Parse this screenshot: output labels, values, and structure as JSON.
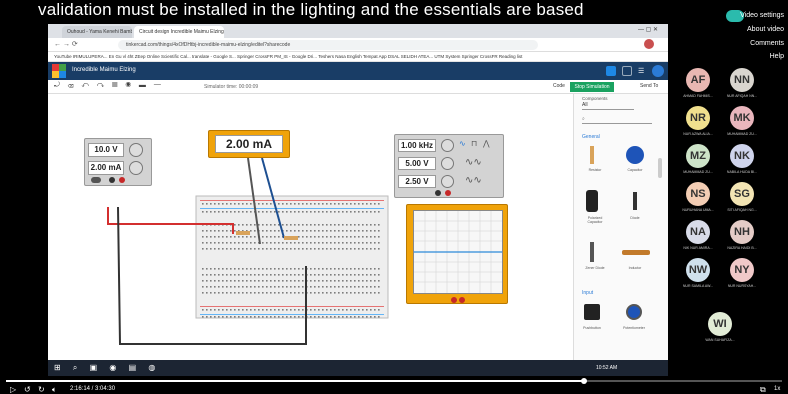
{
  "caption": "validation must be installed in the lighting and the essentials are based",
  "overlay_menu": [
    "Video settings",
    "About video",
    "Comments",
    "Help"
  ],
  "browser": {
    "tabs": [
      "Ouhoud - Yama Kenehi Bambu",
      "Circuit design Incredible Maimu Elzing"
    ],
    "url": "tinkercad.com/things/4xOfDHtbj-incredible-maimu-elzing/editel?sharecode",
    "bookmarks": "YouTube  IRIMULUPERA...  En Gu vl 4ht ZEep  Online Scientific Cal...  translate - Google S...  Springer CrossFR  PM_IS - Google Dri...  Teshers Nasa  English Tempat App  DSAL SELIDH ATEA...  UTM System  Springer CrossFR  Reading list"
  },
  "app": {
    "name": "Incredible Maimu Elzing",
    "sim_time": "Simulator time: 00:00:09",
    "code_label": "Code",
    "stop_label": "Stop Simulation",
    "send_label": "Send To"
  },
  "power_supply": {
    "voltage": "10.0 V",
    "current": "2.00 mA"
  },
  "multimeter": {
    "reading": "2.00 mA"
  },
  "function_generator": {
    "frequency": "1.00 kHz",
    "amplitude": "5.00 V",
    "offset": "2.50 V"
  },
  "sidepanel": {
    "header": "Components",
    "filter": "All",
    "section_general": "General",
    "section_input": "Input",
    "components": [
      "Resistor",
      "Capacitor",
      "Polarized Capacitor",
      "Diode",
      "Zener Diode",
      "Inductor",
      "Pushbutton",
      "Potentiometer"
    ]
  },
  "taskbar": {
    "time": "10:52 AM"
  },
  "participants": [
    {
      "initials": "AF",
      "name": "AHMAD FAHMIS...",
      "color": "#e8b7b2"
    },
    {
      "initials": "NN",
      "name": "NUR AFIQAH NN...",
      "color": "#d9d5cf"
    },
    {
      "initials": "NR",
      "name": "NUR AZWA ALIA...",
      "color": "#f1e08e"
    },
    {
      "initials": "MK",
      "name": "MUHAMMAD ZU...",
      "color": "#e9b6bd"
    },
    {
      "initials": "MZ",
      "name": "MUHAMMAD ZU...",
      "color": "#cde3c8"
    },
    {
      "initials": "NK",
      "name": "NABILA HUDA BI...",
      "color": "#cfd4ec"
    },
    {
      "initials": "NS",
      "name": "NURUHANA UMA...",
      "color": "#f3cdb4"
    },
    {
      "initials": "SG",
      "name": "SITI AFIQAH NG...",
      "color": "#f3e5b4"
    },
    {
      "initials": "NA",
      "name": "NIK NUR AMIRA...",
      "color": "#d8dbe8"
    },
    {
      "initials": "NH",
      "name": "NAZIRA HAIDI B...",
      "color": "#e4ccc7"
    },
    {
      "initials": "NW",
      "name": "NUR SAMILA AW...",
      "color": "#cfe0ec"
    },
    {
      "initials": "NY",
      "name": "NUR NURSYAH...",
      "color": "#f0c9c9"
    },
    {
      "initials": "WI",
      "name": "WAN SUHAFIZA...",
      "color": "#e2ecd6"
    }
  ],
  "player": {
    "timecode": "2:16:14 / 3:04:30",
    "progress_fraction": 0.745,
    "speed": "1x"
  },
  "colors": {
    "header": "#193d66",
    "accent": "#f0a30a",
    "stop": "#1aa260",
    "scope_line": "#2d8ad8"
  }
}
